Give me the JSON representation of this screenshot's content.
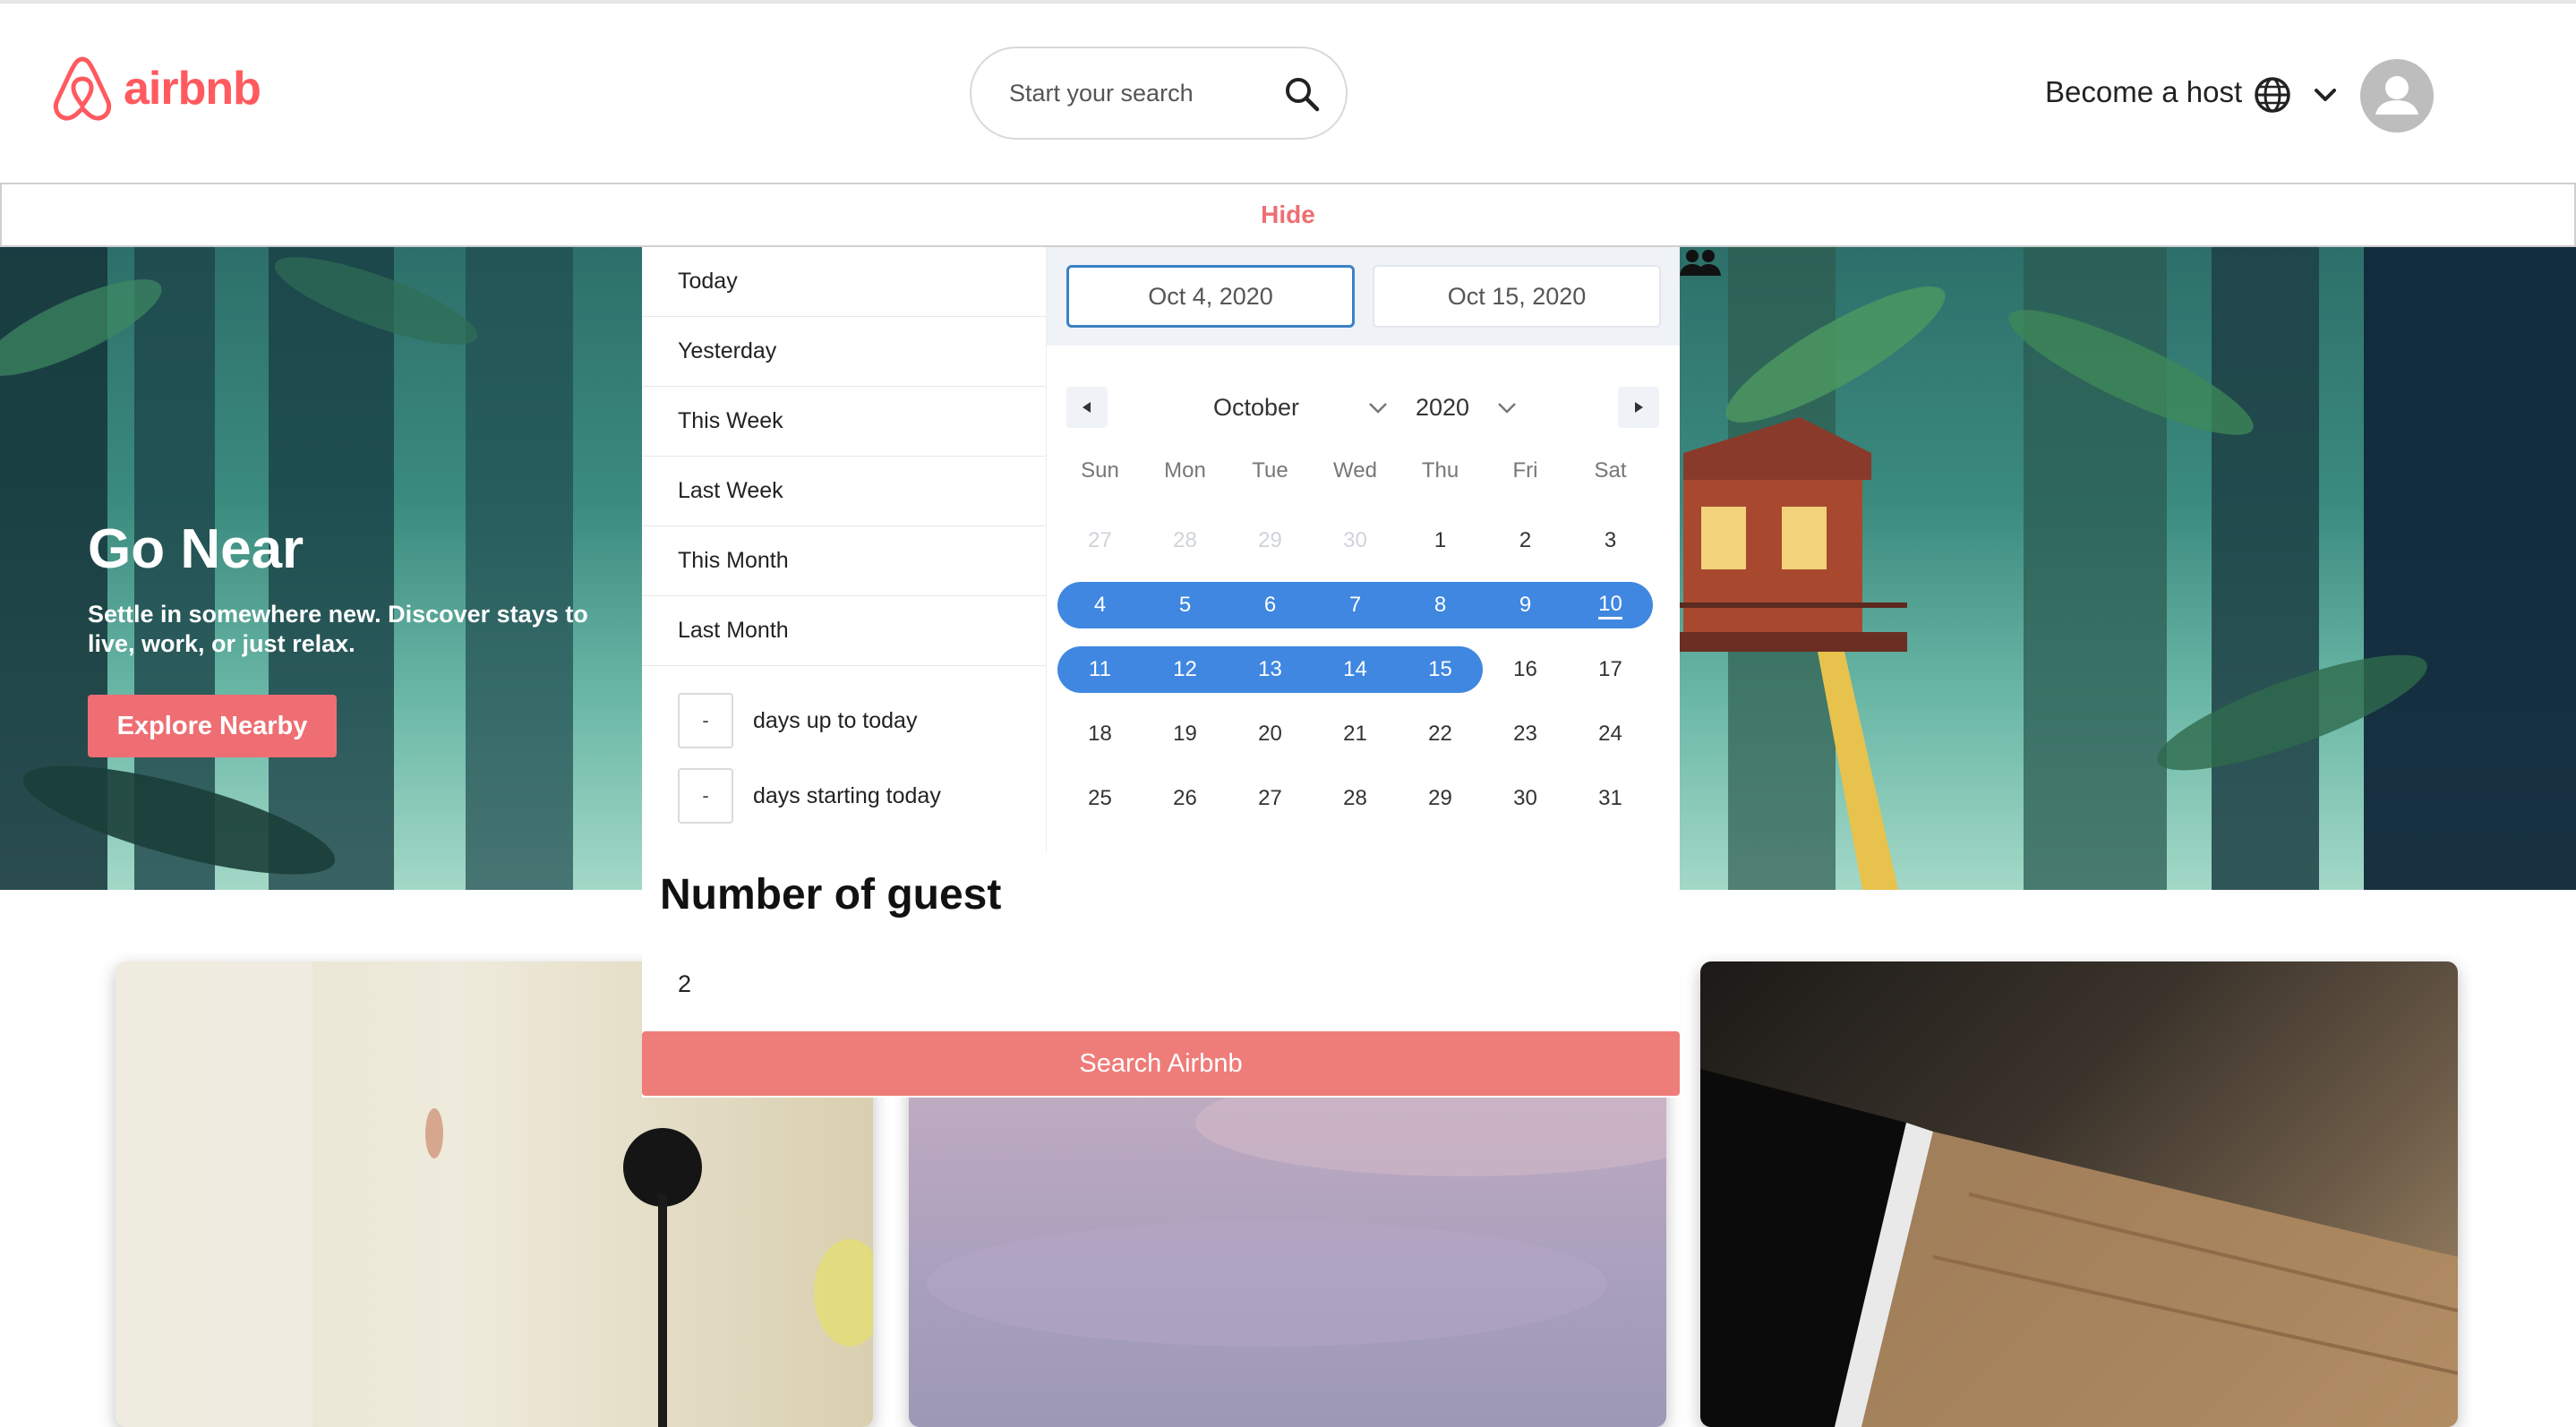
{
  "header": {
    "logo_text": "airbnb",
    "search_placeholder": "Start your search",
    "host_label": "Become a host"
  },
  "hidebar": {
    "label": "Hide"
  },
  "hero": {
    "title": "Go Near",
    "subtitle": "Settle in somewhere new. Discover stays to live, work, or just relax.",
    "button_label": "Explore Nearby"
  },
  "picker": {
    "presets": [
      "Today",
      "Yesterday",
      "This Week",
      "Last Week",
      "This Month",
      "Last Month"
    ],
    "days_up_value": "-",
    "days_up_label": "days up to today",
    "days_start_value": "-",
    "days_start_label": "days starting today",
    "start_date": "Oct 4, 2020",
    "end_date": "Oct 15, 2020",
    "month": "October",
    "year": "2020",
    "weekdays": [
      "Sun",
      "Mon",
      "Tue",
      "Wed",
      "Thu",
      "Fri",
      "Sat"
    ],
    "weeks": [
      [
        "27",
        "28",
        "29",
        "30",
        "1",
        "2",
        "3"
      ],
      [
        "4",
        "5",
        "6",
        "7",
        "8",
        "9",
        "10"
      ],
      [
        "11",
        "12",
        "13",
        "14",
        "15",
        "16",
        "17"
      ],
      [
        "18",
        "19",
        "20",
        "21",
        "22",
        "23",
        "24"
      ],
      [
        "25",
        "26",
        "27",
        "28",
        "29",
        "30",
        "31"
      ]
    ],
    "muted_days_first_week": 4,
    "today": "10",
    "selected_start": "4",
    "selected_end": "15"
  },
  "guests": {
    "title": "Number of guest",
    "value": "2",
    "search_button": "Search Airbnb"
  },
  "colors": {
    "brand": "#FF5A5F",
    "accent_pink": "#EE6E73",
    "range_blue": "#3f87e0"
  }
}
